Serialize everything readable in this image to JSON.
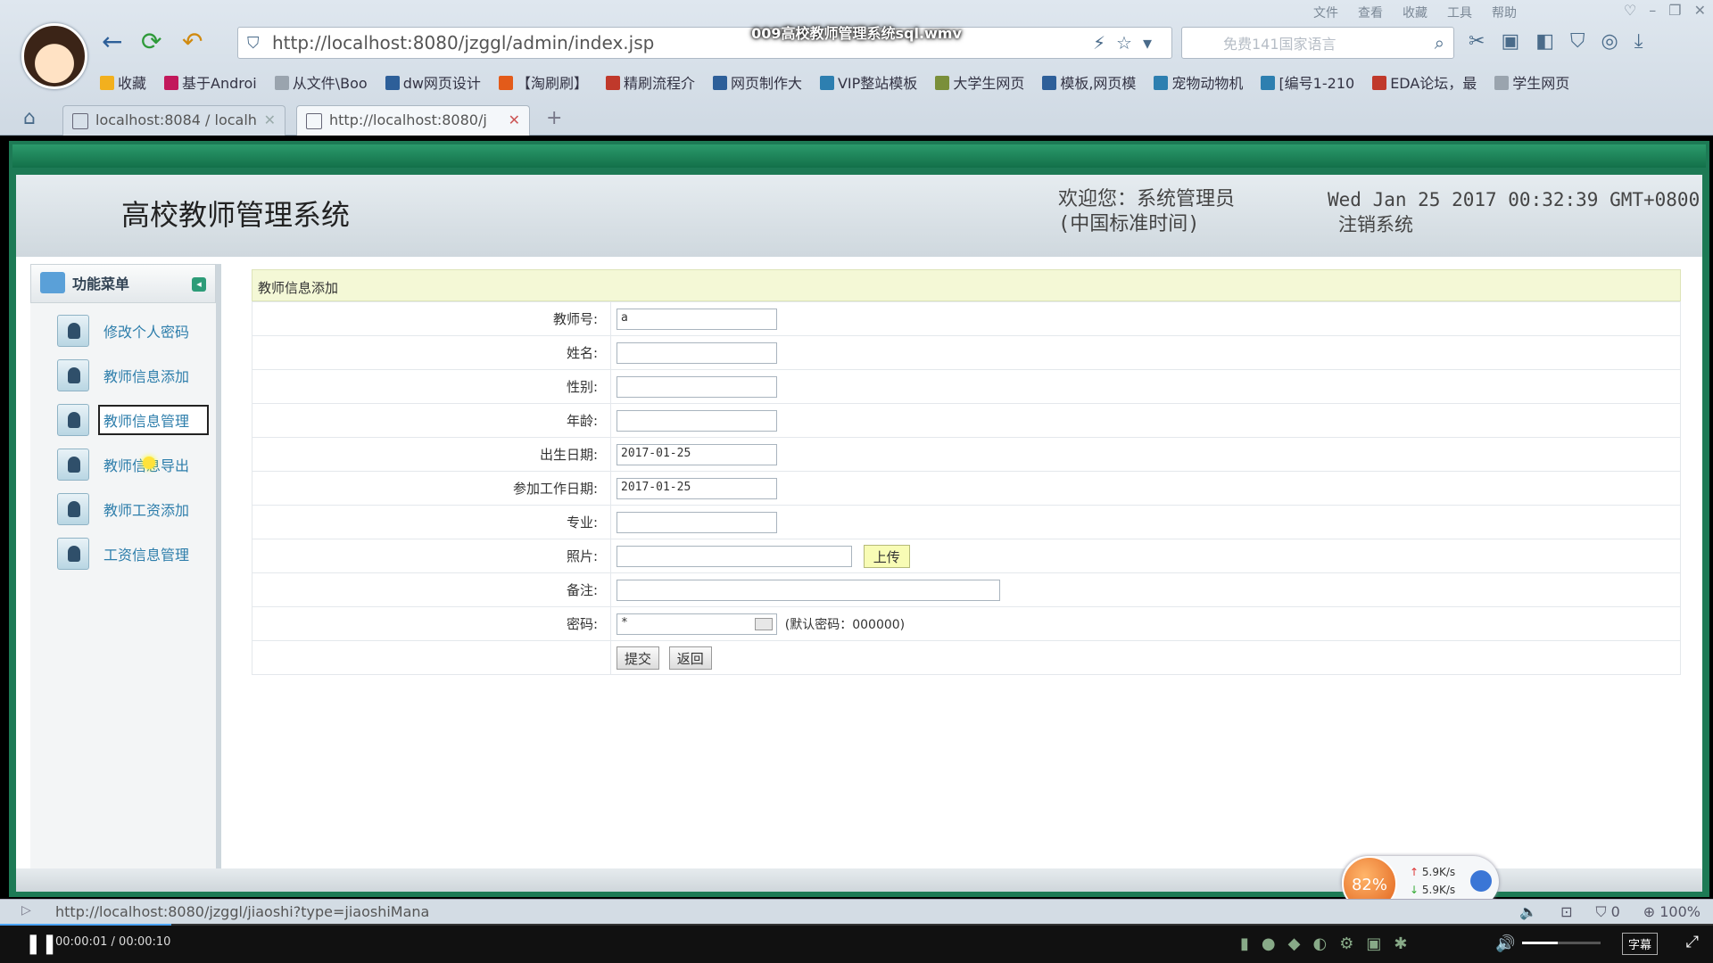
{
  "video": {
    "title": "009高校教师管理系统sql.wmv",
    "current_time": "00:00:01",
    "total_time": "00:00:10",
    "subtitle_button": "字幕",
    "progress": 0.1,
    "volume": 0.45
  },
  "browser": {
    "menu": [
      "文件",
      "查看",
      "收藏",
      "工具",
      "帮助"
    ],
    "address": "http://localhost:8080/jzggl/admin/index.jsp",
    "search_placeholder": "免费141国家语言",
    "bookmarks": [
      {
        "label": "收藏",
        "color": "#f2b01e"
      },
      {
        "label": "基于Androi",
        "color": "#c2185b"
      },
      {
        "label": "从文件\\Boo",
        "color": "#9aa4ae"
      },
      {
        "label": "dw网页设计",
        "color": "#2d5f99"
      },
      {
        "label": "【淘刷刷】",
        "color": "#e35b1a"
      },
      {
        "label": "精刷流程介",
        "color": "#c0392b"
      },
      {
        "label": "网页制作大",
        "color": "#2d5f99"
      },
      {
        "label": "VIP整站模板",
        "color": "#2d7fb0"
      },
      {
        "label": "大学生网页",
        "color": "#7a8f3a"
      },
      {
        "label": "模板,网页模",
        "color": "#2d5f99"
      },
      {
        "label": "宠物动物机",
        "color": "#2d7fb0"
      },
      {
        "label": "[编号1-210",
        "color": "#2d7fb0"
      },
      {
        "label": "EDA论坛，最",
        "color": "#c0392b"
      },
      {
        "label": "学生网页",
        "color": "#9aa4ae"
      }
    ],
    "tabs": [
      {
        "label": "localhost:8084 / localh"
      },
      {
        "label": "http://localhost:8080/j"
      }
    ],
    "status_url": "http://localhost:8080/jzggl/jiaoshi?type=jiaoshiMana",
    "status_zoom": "100%",
    "status_count": "0"
  },
  "speed_widget": {
    "percent": "82%",
    "up": "5.9K/s",
    "down": "5.9K/s"
  },
  "app": {
    "system_title": "高校教师管理系统",
    "welcome": "欢迎您：系统管理员",
    "datetime_line1": "Wed Jan 25 2017 00:32:39 GMT+0800",
    "datetime_line2": "(中国标准时间)",
    "logout": "注销系统",
    "sidebar": {
      "title": "功能菜单",
      "items": [
        {
          "label": "修改个人密码"
        },
        {
          "label": "教师信息添加"
        },
        {
          "label": "教师信息管理"
        },
        {
          "label": "教师信息导出"
        },
        {
          "label": "教师工资添加"
        },
        {
          "label": "工资信息管理"
        }
      ]
    },
    "form": {
      "panel_title": "教师信息添加",
      "fields": {
        "teacher_no": {
          "label": "教师号:",
          "value": "a"
        },
        "name": {
          "label": "姓名:",
          "value": ""
        },
        "gender": {
          "label": "性别:",
          "value": ""
        },
        "age": {
          "label": "年龄:",
          "value": ""
        },
        "birth_date": {
          "label": "出生日期:",
          "value": "2017-01-25"
        },
        "work_date": {
          "label": "参加工作日期:",
          "value": "2017-01-25"
        },
        "major": {
          "label": "专业:",
          "value": ""
        },
        "photo": {
          "label": "照片:",
          "value": ""
        },
        "remark": {
          "label": "备注:",
          "value": ""
        },
        "password": {
          "label": "密码:",
          "value": "*"
        }
      },
      "upload_button": "上传",
      "password_hint": "(默认密码：000000)",
      "submit_button": "提交",
      "back_button": "返回"
    }
  }
}
